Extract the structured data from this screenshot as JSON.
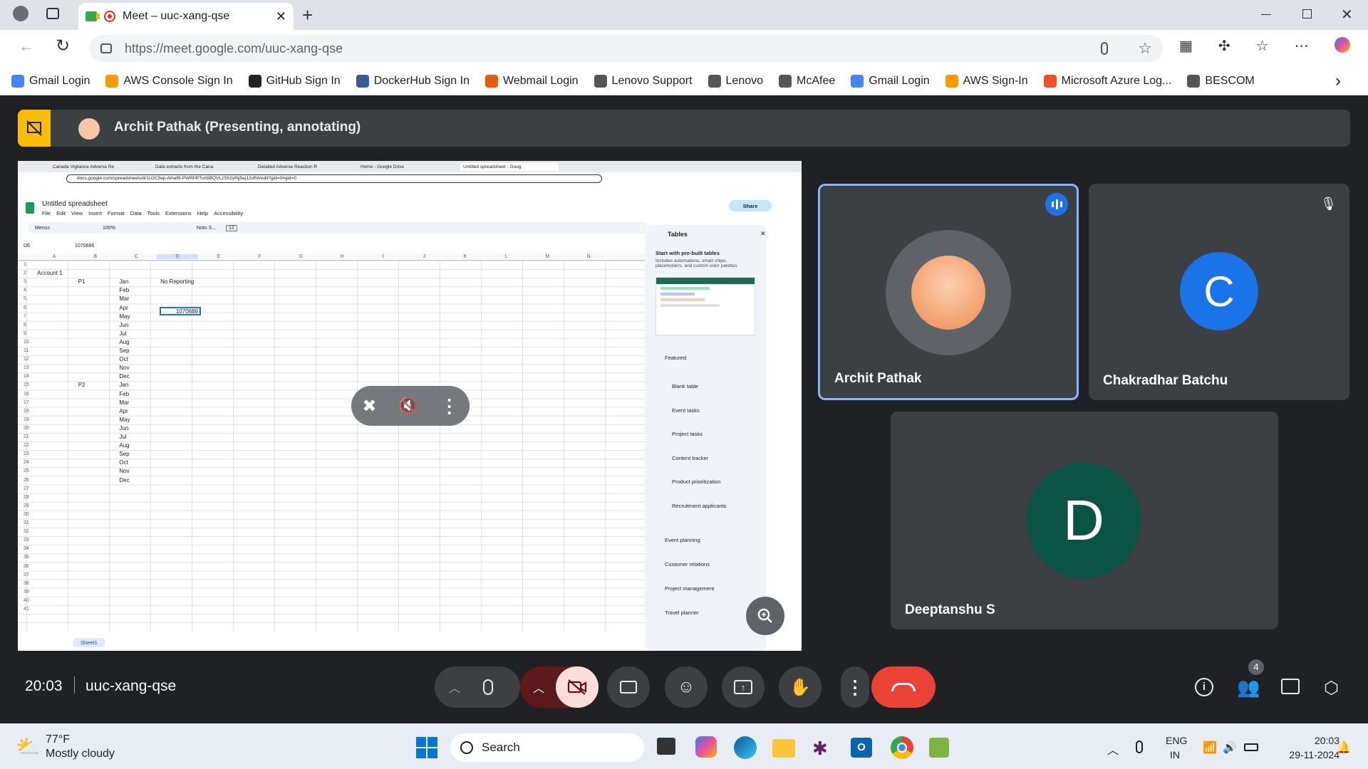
{
  "browser": {
    "tab_title": "Meet – uuc-xang-qse",
    "url": "https://meet.google.com/uuc-xang-qse",
    "bookmarks": [
      "Gmail Login",
      "AWS Console Sign In",
      "GitHub Sign In",
      "DockerHub Sign In",
      "Webmail Login",
      "Lenovo Support",
      "Lenovo",
      "McAfee",
      "Gmail Login",
      "AWS Sign-In",
      "Microsoft Azure Log...",
      "BESCOM"
    ]
  },
  "meet": {
    "presenter_label": "Archit Pathak (Presenting, annotating)",
    "time": "20:03",
    "meeting_code": "uuc-xang-qse",
    "participant_count": "4",
    "participants": [
      {
        "name": "Archit Pathak",
        "initial": ""
      },
      {
        "name": "Chakradhar Batchu",
        "initial": "C",
        "color": "#1a73e8"
      },
      {
        "name": "Deeptanshu S",
        "initial": "D",
        "color": "#0b5345"
      }
    ]
  },
  "shared_screen": {
    "tabs": [
      "Canada Vigilance Adverse Re",
      "Data extracts from the Cana",
      "Detailed Adverse Reaction R",
      "Home - Google Drive",
      "Untitled spreadsheet - Goog"
    ],
    "url": "docs.google.com/spreadsheets/d/1U2C5ep-rkhaRl-PWRhRTuh5BQVLzSh2yRjj5ej12vR4/edit?gid=0#gid=0",
    "doc_title": "Untitled spreadsheet",
    "menus": [
      "File",
      "Edit",
      "View",
      "Insert",
      "Format",
      "Data",
      "Tools",
      "Extensions",
      "Help",
      "Accessibility"
    ],
    "toolbar": {
      "menus": "Menus",
      "zoom": "100%",
      "font": "Noto S...",
      "font_size": "12",
      "share": "Share"
    },
    "cell_ref": "D6",
    "formula": "1070686",
    "columns": [
      "A",
      "B",
      "C",
      "D",
      "E",
      "F",
      "G",
      "H",
      "I",
      "J",
      "K",
      "L",
      "M",
      "N"
    ],
    "rows": [
      "1",
      "2",
      "3",
      "4",
      "5",
      "6",
      "7",
      "8",
      "9",
      "10",
      "11",
      "12",
      "13",
      "14",
      "15",
      "16",
      "17",
      "18",
      "19",
      "20",
      "21",
      "22",
      "23",
      "24",
      "25",
      "26",
      "27",
      "28",
      "29",
      "30",
      "31",
      "32",
      "33",
      "34",
      "35",
      "36",
      "37",
      "38",
      "39",
      "40",
      "41"
    ],
    "cells": {
      "a2": "Account 1",
      "b3": "P1",
      "b15": "P2",
      "d3": "No Reporting",
      "d6": "1070686",
      "months": [
        "Jan",
        "Feb",
        "Mar",
        "Apr",
        "May",
        "Jun",
        "Jul",
        "Aug",
        "Sep",
        "Oct",
        "Nov",
        "Dec"
      ]
    },
    "sheet_tab": "Sheet1",
    "sidebar": {
      "title": "Tables",
      "heading": "Start with pre-built tables",
      "desc": "Includes automations, smart chips, placeholders, and custom color palettes",
      "featured": "Featured",
      "items": [
        "Blank table",
        "Event tasks",
        "Project tasks",
        "Content tracker",
        "Product prioritization",
        "Recruitment applicants"
      ],
      "groups": [
        "Event planning",
        "Customer relations",
        "Project management",
        "Travel planner"
      ]
    }
  },
  "taskbar": {
    "weather_temp": "77°F",
    "weather_desc": "Mostly cloudy",
    "search": "Search",
    "lang": "ENG",
    "region": "IN",
    "time": "20:03",
    "date": "29-11-2024"
  }
}
